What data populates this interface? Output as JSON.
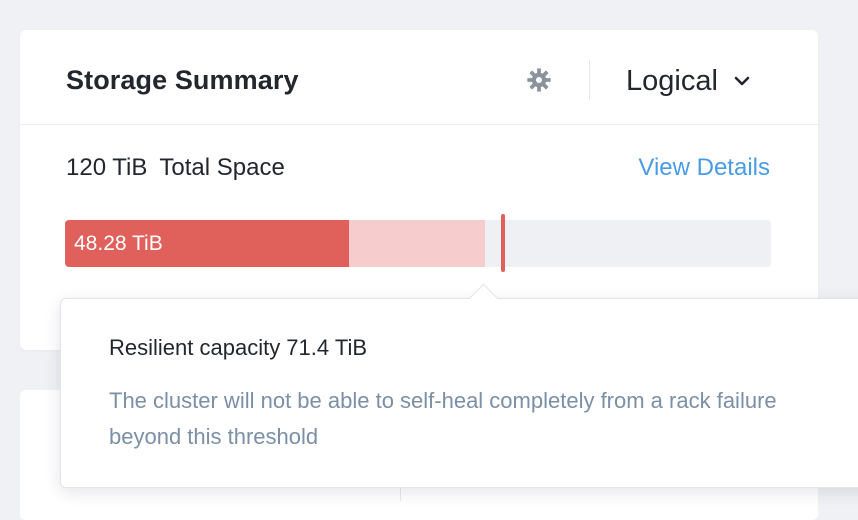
{
  "colors": {
    "page_background": "#f0f1f4",
    "card_background": "#ffffff",
    "used": "#e0605c",
    "resilient": "#f7cccc",
    "free": "#eef0f3",
    "link": "#4a9be6",
    "muted_text": "#7b8fa6"
  },
  "header": {
    "title": "Storage Summary",
    "settings_icon": "gear-icon",
    "view_mode": "Logical",
    "view_mode_icon": "chevron-down-icon"
  },
  "summary": {
    "total_value": "120 TiB",
    "total_label": "Total Space",
    "view_details": "View Details"
  },
  "usage_bar": {
    "used_label": "48.28 TiB",
    "total_tib": 120,
    "used_tib": 48.28,
    "resilient_tib": 71.4,
    "threshold_tib": 66.5
  },
  "tooltip": {
    "title": "Resilient capacity 71.4 TiB",
    "body": "The cluster will not be able to self-heal completely from a rack failure beyond this threshold"
  }
}
